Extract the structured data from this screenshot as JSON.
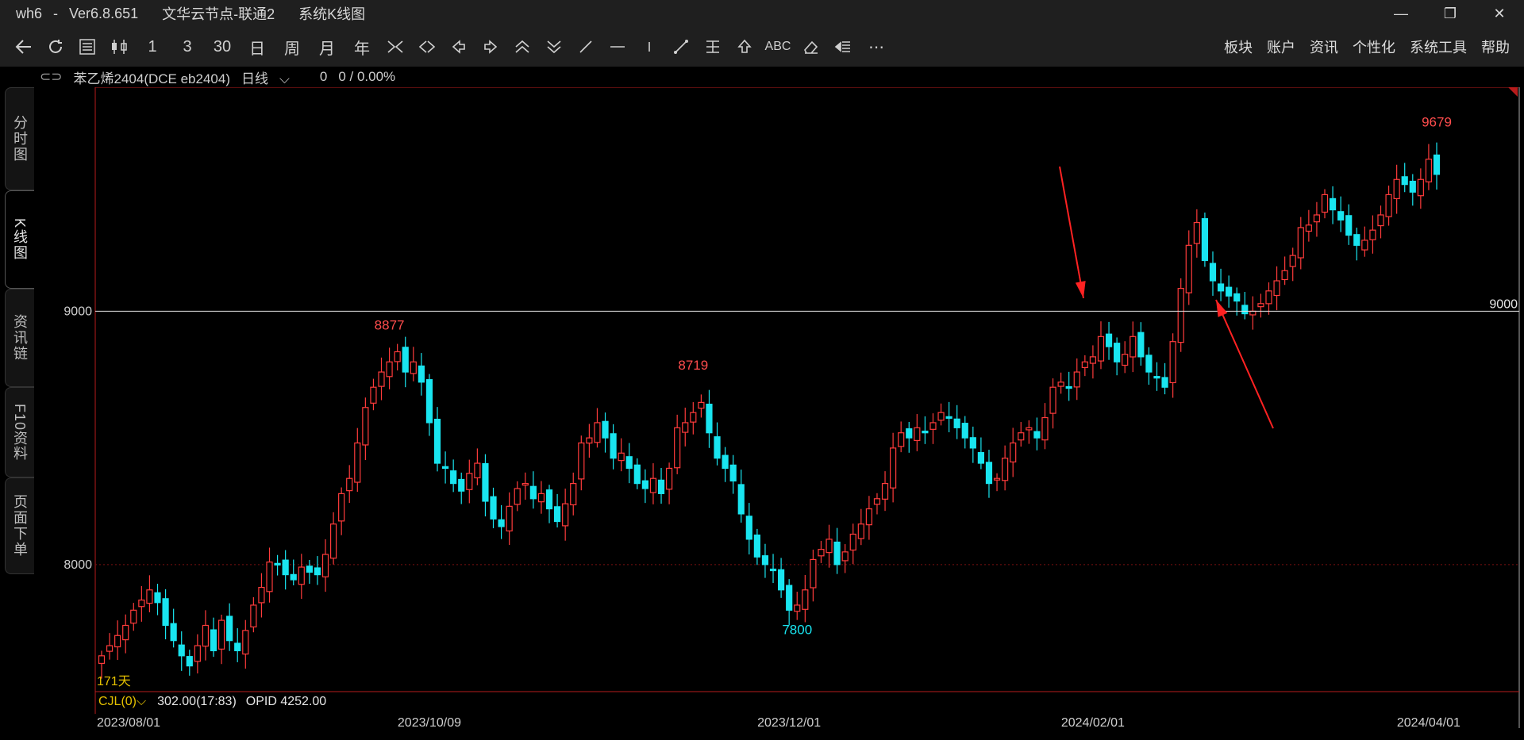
{
  "window": {
    "app": "wh6",
    "version": "Ver6.8.651",
    "server": "文华云节点-联通2",
    "view_title": "系统K线图",
    "minimize": "—",
    "restore": "❐",
    "close": "✕"
  },
  "toolbar": {
    "icons": [
      "back-arrow",
      "refresh",
      "list",
      "candle-toggle",
      "line-1",
      "line-3",
      "line-30",
      "day",
      "week",
      "month",
      "year",
      "zoom-in",
      "zoom-out",
      "left",
      "right",
      "up-double",
      "down-double",
      "draw-line",
      "horizontal-line",
      "vertical-line",
      "segment",
      "parallel",
      "up-arrow",
      "text",
      "eraser",
      "indicator",
      "more"
    ],
    "glyphs": {
      "line_1": "1",
      "line_3": "3",
      "line_30": "30",
      "day": "日",
      "week": "周",
      "month": "月",
      "year": "年",
      "text": "ABC",
      "more": "⋯"
    },
    "menus": [
      "板块",
      "账户",
      "资讯",
      "个性化",
      "系统工具",
      "帮助"
    ]
  },
  "contract": {
    "name": "苯乙烯2404(DCE eb2404)",
    "period": "日线",
    "value": "0",
    "change": "0 / 0.00%"
  },
  "side_tabs": [
    "分时图",
    "K线图",
    "资讯链",
    "F10资料",
    "页面下单"
  ],
  "active_tab": 1,
  "colors": {
    "up": "#ff3b3b",
    "down": "#19e5f0",
    "frame": "#b81c1c",
    "hline": "#e6e6e6",
    "annotation": "#ff2222"
  },
  "chart_data": {
    "type": "candlestick",
    "ylim": [
      7580,
      9790
    ],
    "y_ticks": [
      8000,
      9000
    ],
    "x_ticks": [
      "2023/08/01",
      "2023/10/09",
      "2023/12/01",
      "2024/02/01",
      "2024/04/01"
    ],
    "x_tick_index": [
      0,
      41,
      86,
      124,
      166
    ],
    "days_label": "171天",
    "horizontal_line": {
      "value": 9000,
      "label": "9000"
    },
    "labels": [
      {
        "text": "8877",
        "index": 36,
        "value": 8877,
        "kind": "high"
      },
      {
        "text": "8719",
        "index": 74,
        "value": 8719,
        "kind": "high"
      },
      {
        "text": "7800",
        "index": 87,
        "value": 7800,
        "kind": "low"
      },
      {
        "text": "9679",
        "index": 167,
        "value": 9679,
        "kind": "high"
      }
    ],
    "closes": [
      7640,
      7680,
      7720,
      7760,
      7820,
      7860,
      7900,
      7850,
      7760,
      7700,
      7640,
      7600,
      7680,
      7760,
      7660,
      7780,
      7700,
      7660,
      7740,
      7840,
      7910,
      8010,
      8000,
      7960,
      7940,
      7990,
      7970,
      7960,
      8040,
      8160,
      8280,
      8340,
      8480,
      8620,
      8700,
      8760,
      8800,
      8840,
      8760,
      8800,
      8720,
      8560,
      8400,
      8380,
      8320,
      8290,
      8360,
      8400,
      8250,
      8180,
      8150,
      8230,
      8300,
      8320,
      8260,
      8280,
      8220,
      8170,
      8240,
      8320,
      8480,
      8500,
      8560,
      8500,
      8420,
      8440,
      8380,
      8320,
      8300,
      8340,
      8280,
      8380,
      8540,
      8560,
      8600,
      8640,
      8520,
      8420,
      8380,
      8330,
      8200,
      8100,
      8030,
      8000,
      7980,
      7900,
      7820,
      7840,
      7900,
      8020,
      8060,
      8100,
      8000,
      8050,
      8120,
      8160,
      8220,
      8260,
      8320,
      8460,
      8520,
      8500,
      8540,
      8520,
      8560,
      8600,
      8580,
      8540,
      8500,
      8460,
      8400,
      8320,
      8340,
      8420,
      8480,
      8520,
      8540,
      8500,
      8580,
      8700,
      8720,
      8700,
      8760,
      8800,
      8820,
      8900,
      8860,
      8800,
      8830,
      8900,
      8820,
      8760,
      8740,
      8700,
      8880,
      9090,
      9260,
      9350,
      9200,
      9120,
      9080,
      9060,
      9040,
      8990,
      9000,
      9030,
      9080,
      9120,
      9160,
      9220,
      9330,
      9340,
      9380,
      9460,
      9400,
      9360,
      9300,
      9260,
      9280,
      9320,
      9380,
      9460,
      9520,
      9500,
      9470,
      9520,
      9600,
      9540
    ]
  }
}
